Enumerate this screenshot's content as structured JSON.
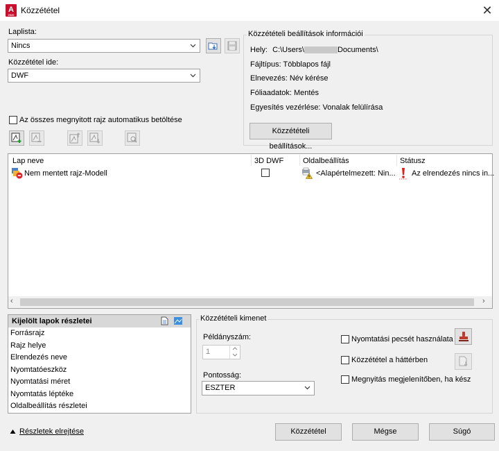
{
  "window": {
    "title": "Közzététel",
    "app_icon_letter": "A",
    "app_icon_sub": "2020"
  },
  "sheetlist": {
    "label": "Laplista:",
    "value": "Nincs",
    "publish_to_label": "Közzététel ide:",
    "publish_to_value": "DWF",
    "auto_load_label": "Az összes megnyitott rajz automatikus betöltése",
    "auto_load_checked": false
  },
  "info": {
    "title": "Közzétételi beállítások információi",
    "location_label": "Hely:",
    "location_value_prefix": "C:\\Users\\",
    "location_value_suffix": "Documents\\",
    "filetype": "Fájltípus: Többlapos fájl",
    "naming": "Elnevezés: Név kérése",
    "layer_info": "Fóliaadatok: Mentés",
    "merge_control": "Egyesítés vezérlése: Vonalak felülírása",
    "settings_button": "Közzétételi beállítások..."
  },
  "sheet_table": {
    "columns": [
      "Lap neve",
      "3D DWF",
      "Oldalbeállítás",
      "Státusz"
    ],
    "rows": [
      {
        "name": "Nem mentett rajz-Modell",
        "dwf3d": false,
        "page_setup": "<Alapértelmezett: Nin...",
        "status": "Az elrendezés nincs in..."
      }
    ]
  },
  "details": {
    "title": "Kijelölt lapok részletei",
    "items": [
      "Forrásrajz",
      "Rajz helye",
      "Elrendezés neve",
      "Nyomtatóeszköz",
      "Nyomtatási méret",
      "Nyomtatás léptéke",
      "Oldalbeállítás részletei"
    ]
  },
  "output": {
    "title": "Közzétételi kimenet",
    "copies_label": "Példányszám:",
    "copies_value": "1",
    "precision_label": "Pontosság:",
    "precision_value": "ESZTER",
    "plot_stamp_label": "Nyomtatási pecsét használata",
    "background_label": "Közzététel a háttérben",
    "open_viewer_label": "Megnyitás megjelenítőben, ha kész"
  },
  "footer": {
    "hide_details": "Részletek elrejtése",
    "publish": "Közzététel",
    "cancel": "Mégse",
    "help": "Súgó"
  }
}
